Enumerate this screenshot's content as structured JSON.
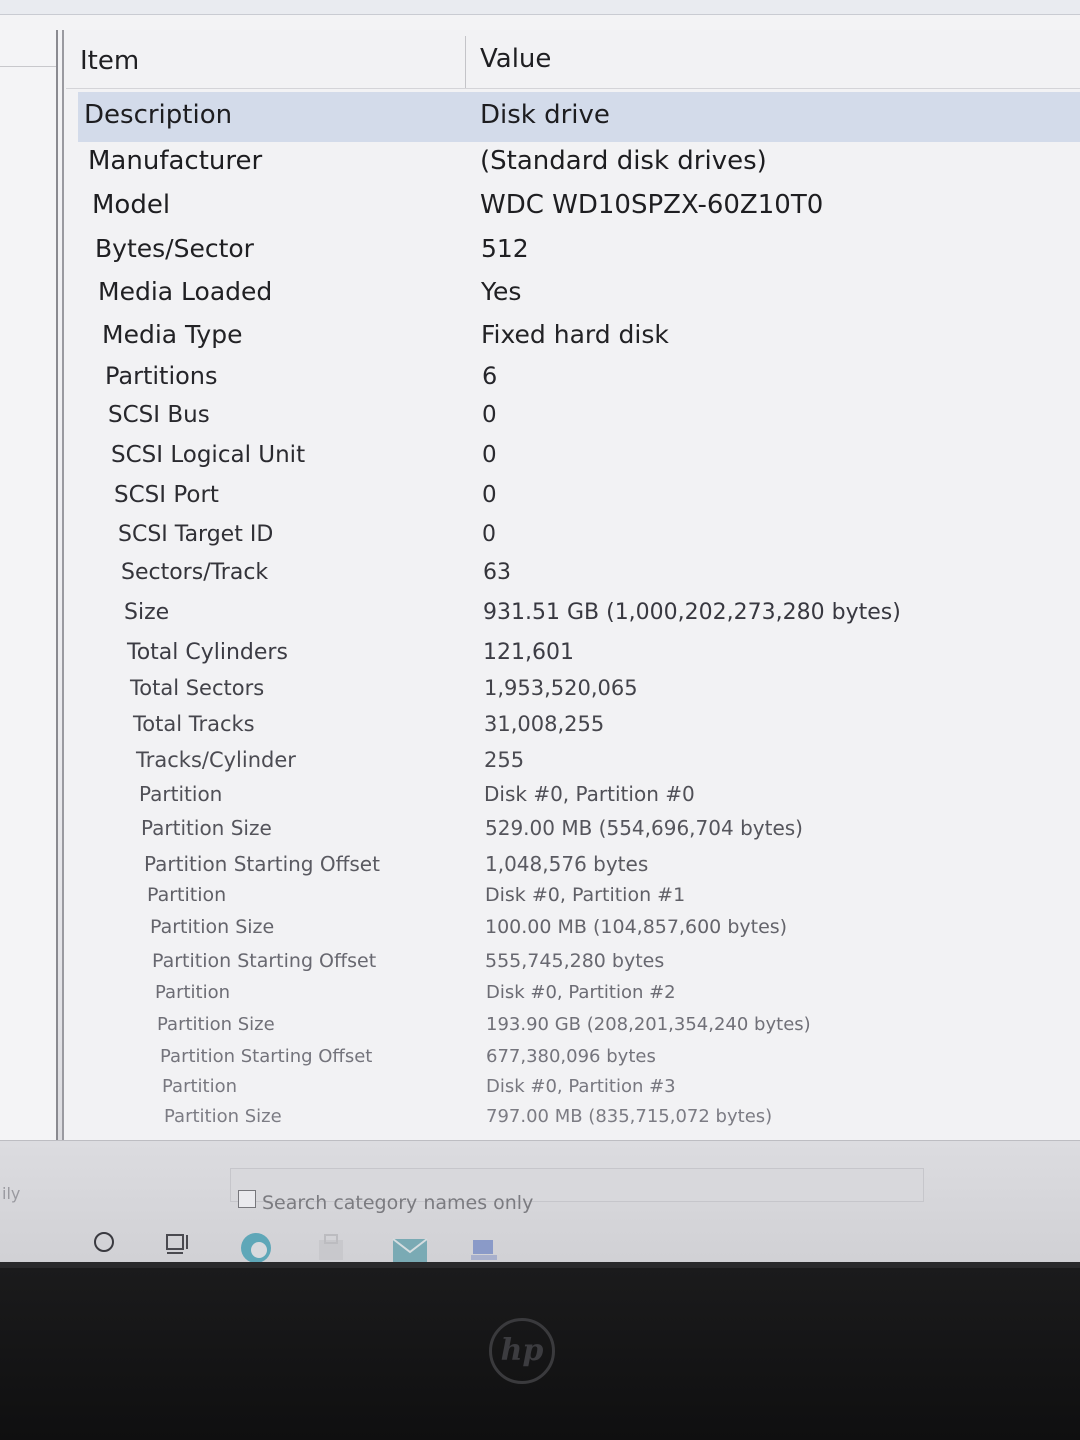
{
  "table": {
    "headers": {
      "item": "Item",
      "value": "Value"
    },
    "rows": [
      {
        "item": "Description",
        "value": "Disk drive"
      },
      {
        "item": "Manufacturer",
        "value": "(Standard disk drives)"
      },
      {
        "item": "Model",
        "value": "WDC WD10SPZX-60Z10T0"
      },
      {
        "item": "Bytes/Sector",
        "value": "512"
      },
      {
        "item": "Media Loaded",
        "value": "Yes"
      },
      {
        "item": "Media Type",
        "value": "Fixed hard disk"
      },
      {
        "item": "Partitions",
        "value": "6"
      },
      {
        "item": "SCSI Bus",
        "value": "0"
      },
      {
        "item": "SCSI Logical Unit",
        "value": "0"
      },
      {
        "item": "SCSI Port",
        "value": "0"
      },
      {
        "item": "SCSI Target ID",
        "value": "0"
      },
      {
        "item": "Sectors/Track",
        "value": "63"
      },
      {
        "item": "Size",
        "value": "931.51 GB (1,000,202,273,280 bytes)"
      },
      {
        "item": "Total Cylinders",
        "value": "121,601"
      },
      {
        "item": "Total Sectors",
        "value": "1,953,520,065"
      },
      {
        "item": "Total Tracks",
        "value": "31,008,255"
      },
      {
        "item": "Tracks/Cylinder",
        "value": "255"
      },
      {
        "item": "Partition",
        "value": "Disk #0, Partition #0"
      },
      {
        "item": "Partition Size",
        "value": "529.00 MB (554,696,704 bytes)"
      },
      {
        "item": "Partition Starting Offset",
        "value": "1,048,576 bytes"
      },
      {
        "item": "Partition",
        "value": "Disk #0, Partition #1"
      },
      {
        "item": "Partition Size",
        "value": "100.00 MB (104,857,600 bytes)"
      },
      {
        "item": "Partition Starting Offset",
        "value": "555,745,280 bytes"
      },
      {
        "item": "Partition",
        "value": "Disk #0, Partition #2"
      },
      {
        "item": "Partition Size",
        "value": "193.90 GB (208,201,354,240 bytes)"
      },
      {
        "item": "Partition Starting Offset",
        "value": "677,380,096 bytes"
      },
      {
        "item": "Partition",
        "value": "Disk #0, Partition #3"
      },
      {
        "item": "Partition Size",
        "value": "797.00 MB (835,715,072 bytes)"
      }
    ],
    "selected_row": 0
  },
  "search": {
    "checkbox_label": "Search category names only",
    "checked": false,
    "left_cut_text": "ily"
  },
  "taskbar": {
    "icons": [
      "cortana-circle-icon",
      "task-view-icon",
      "edge-icon",
      "store-icon",
      "mail-icon",
      "system-info-icon"
    ]
  },
  "bezel": {
    "logo_text": "hp"
  },
  "colors": {
    "selection": "#d3dbea",
    "text": "#232326",
    "background": "#f2f2f4"
  }
}
